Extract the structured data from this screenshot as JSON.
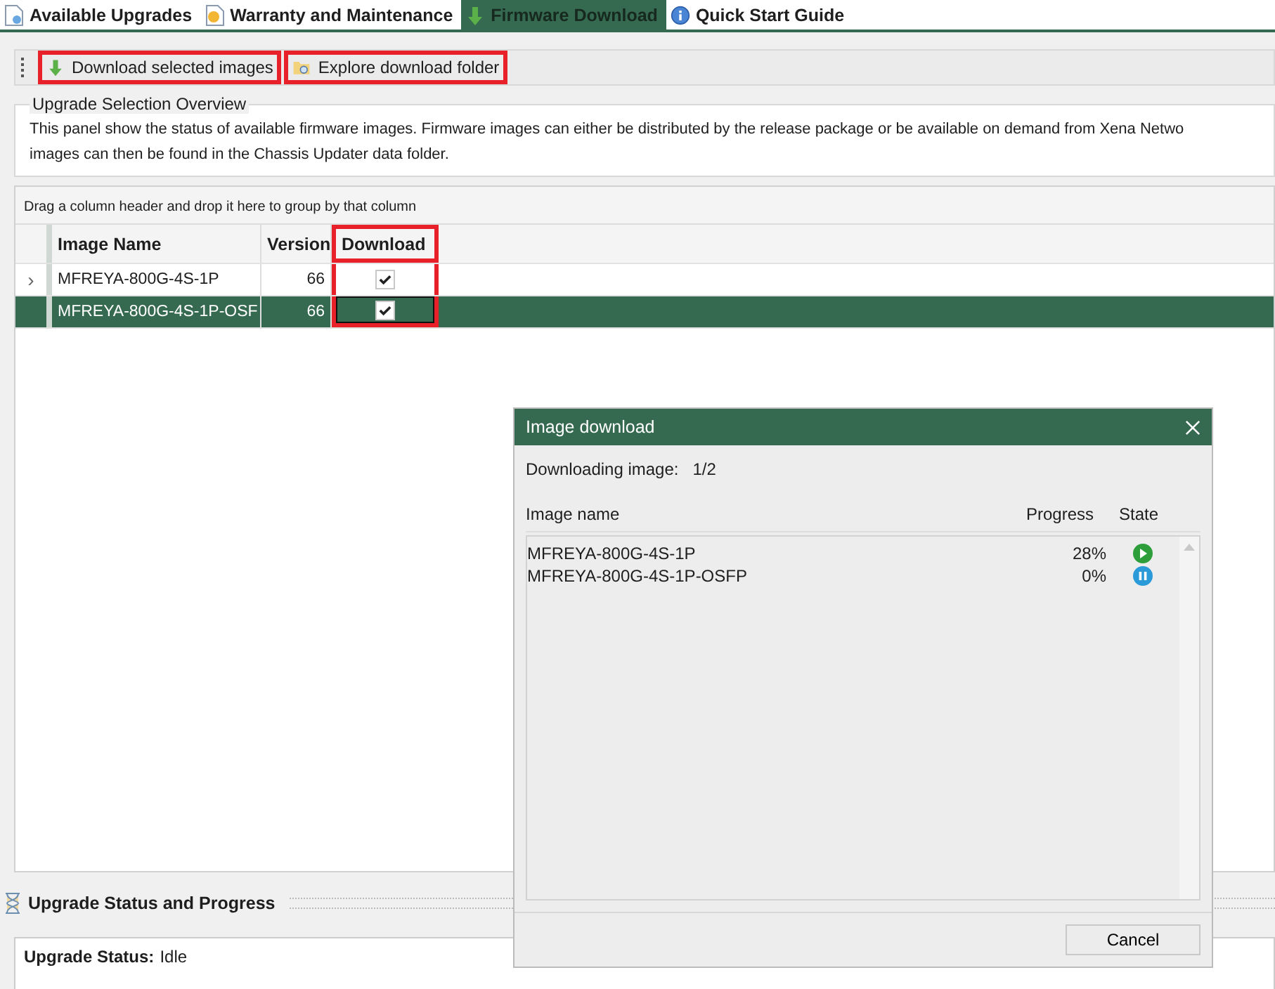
{
  "tabs": [
    {
      "label": "Available Upgrades",
      "kind": "page",
      "selected": false
    },
    {
      "label": "Warranty and Maintenance",
      "kind": "certificate",
      "selected": false
    },
    {
      "label": "Firmware Download",
      "kind": "download",
      "selected": true
    },
    {
      "label": "Quick Start Guide",
      "kind": "info",
      "selected": false
    }
  ],
  "toolbar": {
    "buttons": [
      {
        "label": "Download selected images",
        "kind": "download",
        "highlighted": true
      },
      {
        "label": "Explore download folder",
        "kind": "folder",
        "highlighted": true
      }
    ]
  },
  "overview": {
    "title": "Upgrade Selection Overview",
    "text": "This panel show the status of available firmware images. Firmware images can either be distributed by the release package or be available on demand from Xena Netwo",
    "text_line2": "images can then be found in the Chassis Updater data folder."
  },
  "grid": {
    "group_hint": "Drag a column header and drop it here to group by that column",
    "columns": [
      {
        "label": "Image Name",
        "highlighted": false
      },
      {
        "label": "Version",
        "highlighted": false
      },
      {
        "label": "Download",
        "highlighted": true
      }
    ],
    "rows": [
      {
        "marker": "›",
        "name": "MFREYA-800G-4S-1P",
        "version": "66",
        "download": true,
        "selected": false
      },
      {
        "name": "MFREYA-800G-4S-1P-OSF",
        "version": "66",
        "download": true,
        "selected": true
      }
    ]
  },
  "status": {
    "title": "Upgrade Status and Progress",
    "label": "Upgrade Status:",
    "value": "Idle"
  },
  "dialog": {
    "title": "Image download",
    "counter_label": "Downloading image:",
    "counter": "1/2",
    "columns": [
      "Image name",
      "Progress",
      "State"
    ],
    "items": [
      {
        "name": "MFREYA-800G-4S-1P",
        "progress": "28%",
        "kind": "play"
      },
      {
        "name": "MFREYA-800G-4S-1P-OSFP",
        "progress": "0%",
        "kind": "pause"
      }
    ],
    "cancel": "Cancel"
  }
}
